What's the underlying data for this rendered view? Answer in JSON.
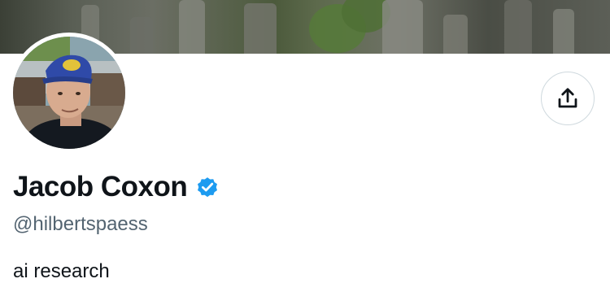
{
  "profile": {
    "display_name": "Jacob Coxon",
    "handle": "@hilbertspaess",
    "bio": "ai research",
    "verified": true
  },
  "icons": {
    "verified": "verified-badge-icon",
    "share": "share-upload-icon"
  },
  "colors": {
    "verified_blue": "#1d9bf0",
    "text_primary": "#0f1419",
    "text_secondary": "#536471",
    "border": "#cfd9de"
  }
}
